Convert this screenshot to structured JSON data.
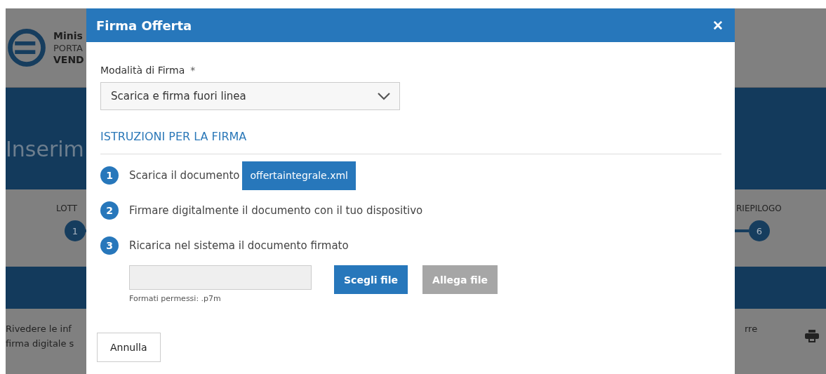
{
  "background": {
    "brand": [
      "Minis",
      "PORTA",
      "VEND"
    ],
    "page_title": "Inserim",
    "steps": [
      {
        "label": "LOTT",
        "number": "1"
      },
      {
        "label": "RIEPILOGO",
        "number": "6"
      }
    ],
    "intro_lines": [
      "Rivedere le inf",
      "firma digitale s"
    ],
    "right_text": "rre"
  },
  "modal": {
    "title": "Firma Offerta",
    "close": "✕",
    "field_label": "Modalità di Firma",
    "required_mark": "*",
    "select_value": "Scarica e firma fuori linea",
    "section_heading": "ISTRUZIONI PER LA FIRMA",
    "steps": [
      {
        "number": "1",
        "text": "Scarica il documento",
        "button": "offertaintegrale.xml"
      },
      {
        "number": "2",
        "text": "Firmare digitalmente il documento con il tuo dispositivo"
      },
      {
        "number": "3",
        "text": "Ricarica nel sistema il documento firmato"
      }
    ],
    "upload": {
      "choose": "Scegli file",
      "attach": "Allega file",
      "attach_disabled": true,
      "hint": "Formati permessi: .p7m"
    },
    "cancel": "Annulla"
  }
}
